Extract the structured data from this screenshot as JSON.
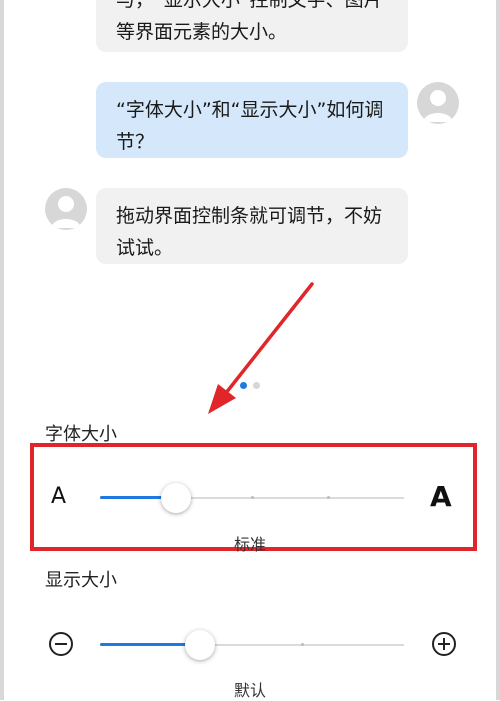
{
  "chat": {
    "top_bubble": "与，“显示大小”控制文字、图片等界面元素的大小。",
    "user_question": "“字体大小”和“显示大小”如何调节？",
    "bot_answer": "拖动界面控制条就可调节，不妨试试。"
  },
  "pager": {
    "page_count": 2,
    "active_index": 0
  },
  "font_size": {
    "title": "字体大小",
    "small_label": "A",
    "large_label": "A",
    "value_label": "标准",
    "level": 0.25
  },
  "display_size": {
    "title": "显示大小",
    "value_label": "默认",
    "level": 0.33
  },
  "colors": {
    "accent": "#1e7ae0",
    "highlight": "#e0262b",
    "user_bubble": "#d5e8fb",
    "bot_bubble": "#f1f1f1"
  }
}
